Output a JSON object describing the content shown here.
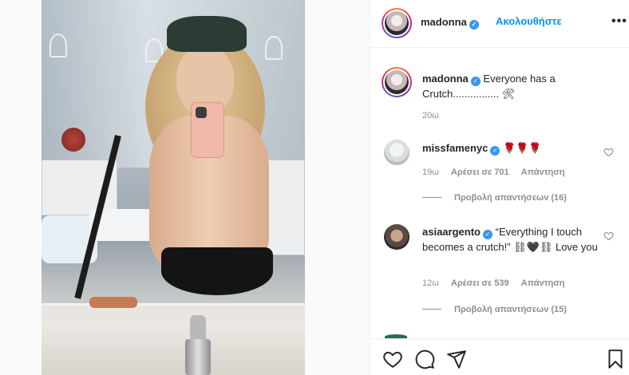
{
  "post": {
    "author": "madonna",
    "follow_label": "Ακολουθήστε",
    "more_label": "•••"
  },
  "caption": {
    "username": "madonna",
    "text": "Everyone has a Crutch................ 🛠",
    "time": "20ω"
  },
  "comments": [
    {
      "username": "missfamenyc",
      "text": "🌹🌹🌹",
      "time": "19ω",
      "likes_label": "Αρέσει σε 701",
      "reply_label": "Απάντηση",
      "view_replies": "Προβολή απαντήσεων (16)"
    },
    {
      "username": "asiaargento",
      "text": "“Everything I touch becomes a crutch!” ⛓🖤⛓ Love you",
      "time": "12ω",
      "likes_label": "Αρέσει σε 539",
      "reply_label": "Απάντηση",
      "view_replies": "Προβολή απαντήσεων (15)"
    }
  ],
  "icons": {
    "verified": "✓",
    "like": "heart-icon",
    "comment": "comment-icon",
    "share": "share-icon",
    "save": "bookmark-icon"
  },
  "colors": {
    "link_blue": "#0095f6",
    "verified_blue": "#3897f0",
    "muted": "#8e8e8e",
    "text": "#262626"
  }
}
